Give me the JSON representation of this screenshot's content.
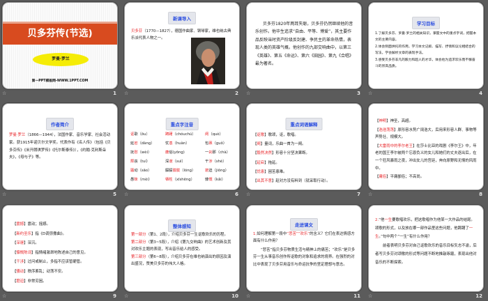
{
  "slides": [
    {
      "number": "1",
      "title": "贝多芬传(节选)",
      "author": "罗曼·罗兰",
      "footer": "第一PPT模板网-WWW.1PPT.COM"
    },
    {
      "number": "2",
      "heading": "新课导入",
      "paras": [
        [
          {
            "r": "贝多芬"
          },
          "（1770—1827），德国作曲家、钢琴家，维也纳古典乐派代表人物之一。"
        ]
      ]
    },
    {
      "number": "3",
      "paras": [
        [
          "贝多芬1820年两耳失聪，贝多芬仍然继续他的音乐创作。他毕生追求“自由、平等、博爱”，其主要作品反映当时资产阶级反封建、争民主的革命热情，表现人类的英雄气概。他创作的九部交响曲中，以第三《英雄》、第五《命运》、第六《田园》、第九《合唱》最为著名。"
        ]
      ]
    },
    {
      "number": "4",
      "heading": "学习目标",
      "paras": [
        [
          "1.了解贝多芬、罗曼·罗兰的相关知识，掌握文中的重点字词，把握本文的主要内容。"
        ],
        [
          "2.体会侧面烘托的作用，学习本文记叙、描写、抒情和议论相结合的写法，学会解析文章的表现手法。"
        ],
        [
          "3.感受贝多芬非凡的毅力和超人的才华，体会他为追求欢乐而不懈奋斗的崇高品质。"
        ]
      ]
    },
    {
      "number": "5",
      "heading": "作者简介",
      "paras": [
        [
          {
            "r": "罗曼·罗兰"
          },
          "（1866—1944），法国作家、音乐学家、社会活动家。获1915年诺贝尔文学奖。代表作有《名人传》（包括《贝多芬传》《米开朗琪罗传》《托尔斯泰传》），《约翰·克利斯朵夫》，《母与子》等。"
        ]
      ]
    },
    {
      "number": "6",
      "heading": "重点字注音",
      "items": [
        [
          {
            "r": "讴"
          },
          "歌（ōu）"
        ],
        [
          {
            "r": "踌躇"
          },
          "（chóuchú）"
        ],
        [
          {
            "r": "阕"
          },
          "（què）"
        ],
        [
          "延",
          {
            "r": "宕"
          },
          "（dàng）"
        ],
        [
          "忧",
          {
            "r": "患"
          },
          "（huàn）"
        ],
        [
          "包",
          {
            "r": "裹"
          },
          "（guǒ）"
        ],
        [
          "抚",
          {
            "r": "慰"
          },
          "（wèi）"
        ],
        [
          {
            "r": "庸"
          },
          "俗(yōng)"
        ],
        [
          "一",
          {
            "r": "刹"
          },
          "那（chà）"
        ],
        [
          {
            "r": "颓"
          },
          "丧（tuí）"
        ],
        [
          "深",
          {
            "r": "邃"
          },
          "（suì）"
        ],
        [
          "干",
          {
            "r": "涉"
          },
          "（shè）"
        ],
        [
          {
            "r": "骚"
          },
          "动（sāo）"
        ],
        [
          "朦朦",
          {
            "r": "胧胧"
          },
          "（lóng）"
        ],
        [
          {
            "r": "窘"
          },
          "迫（jiǒng）"
        ],
        [
          "愚",
          {
            "r": "昧"
          },
          "（mèi）"
        ],
        [
          {
            "r": "牺牲"
          },
          "（xīshēng）"
        ],
        [
          "慷",
          {
            "r": "慨"
          },
          "（kǎi）"
        ]
      ]
    },
    {
      "number": "7",
      "heading": "重点词语解释",
      "paras": [
        [
          "【",
          {
            "r": "讴歌"
          },
          "】歌颂，讴，歌唱。"
        ],
        [
          "【",
          {
            "r": "阕"
          },
          "】量词，乐曲一首为一阕。"
        ],
        [
          "【",
          {
            "r": "毅然决然"
          },
          "】形容十分坚决果断。"
        ],
        [
          "【",
          {
            "r": "延宕"
          },
          "】拖延。"
        ],
        [
          "【",
          {
            "r": "忧患"
          },
          "】困苦患难。"
        ],
        [
          "【",
          {
            "r": "出其不意"
          },
          "】趁对方没有料到（就采取行动）。"
        ]
      ]
    },
    {
      "number": "8",
      "paras": [
        [
          "【",
          {
            "r": "神明"
          },
          "】神圣，高超。"
        ],
        [
          "【",
          {
            "r": "浩浩荡荡"
          },
          "】原形容水势广阔浩大，后用来形容人群、事物等声势壮、规模大。"
        ],
        [
          "【",
          {
            "r": "大雷雨中的李尔老王"
          },
          "】在莎士比亚的戏剧《李尔王》中，年老的国王李尔被两个忘恩负义的女儿和她们的丈夫逐出后，在一个狂风暴雨之夜，冲出女儿的宫廷，奔向原野和无情的风雨中。"
        ],
        [
          "【",
          {
            "r": "庸俗"
          },
          "】平庸鄙俗；不高尚。"
        ]
      ]
    },
    {
      "number": "9",
      "paras": [
        [
          "【",
          {
            "r": "震撼"
          },
          "】震动；摇撼。"
        ],
        [
          "【",
          {
            "r": "新约圣乐"
          },
          "】指《D调弥撒曲》。"
        ],
        [
          "【",
          {
            "r": "深邃"
          },
          "】深沉。"
        ],
        [
          "【",
          {
            "r": "慷慨陈词"
          },
          "】指情绪激昂地陈述自己的意见。"
        ],
        [
          "【",
          {
            "r": "干涉"
          },
          "】过问或制止，多指不应该管硬管。"
        ],
        [
          "【",
          {
            "r": "骚动"
          },
          "】秩序紊乱；动荡不安。"
        ],
        [
          "【",
          {
            "r": "窘迫"
          },
          "】非常穷困。"
        ]
      ]
    },
    {
      "number": "10",
      "heading": "整体感知",
      "paras": [
        [
          {
            "r": "第一部分"
          },
          "（第1、2段），介绍贝多芬一生讴歌欢乐的历程。"
        ],
        [
          {
            "r": "第二部分"
          },
          "（第3~5段），介绍《第九交响曲》的艺术创新及其对欢乐主题的表现，写出音乐给人的感受。"
        ],
        [
          {
            "r": "第三部分"
          },
          "（第6~8段），介绍贝多芬在维也纳演出的原因及演出盛况，赞美贝多芬的伟大人格。"
        ]
      ]
    },
    {
      "number": "11",
      "heading": "走进课文",
      "paras": [
        [
          {
            "r": "1."
          },
          "如何理解第一段中",
          {
            "r": "“悲苦”“欢乐”"
          },
          "的含义？它们在表达情感方面有什么作用？"
        ],
        [
          "“悲苦”指贝多芬物质生活与精神上的痛苦；“欢乐”是贝多芬一生从事音乐创作所讴歌的对象和追求的境界。在强烈的对比中表现了贝多芬用音乐与命运抗争的坚定理想与意志。"
        ]
      ]
    },
    {
      "number": "12",
      "paras": [
        [
          {
            "r": "2."
          },
          "“他",
          {
            "r": "一生"
          },
          "要歌唱欢乐，把这歌唱作为他某一大作品的结尾。颂歌的形式，以及放在哪一部作品里这些问题，他踌躇了",
          {
            "r": "一生"
          },
          "。”句中两个“一生”有什么作用？"
        ],
        [
          "前者表明贝多芬对自己讴歌欢乐的音乐目标矢志不渝，后者写贝多芬对颂歌的形式等问题不断地推敲琢磨，表现出他对音乐的不断探索。"
        ]
      ]
    }
  ],
  "transition_icon": "animation-star-icon",
  "colors": {
    "accent_red": "#e8262a",
    "heading_blue": "#2a4de0",
    "band_orange": "#d84b1f",
    "ellipse_yellow": "#f5ec06"
  }
}
